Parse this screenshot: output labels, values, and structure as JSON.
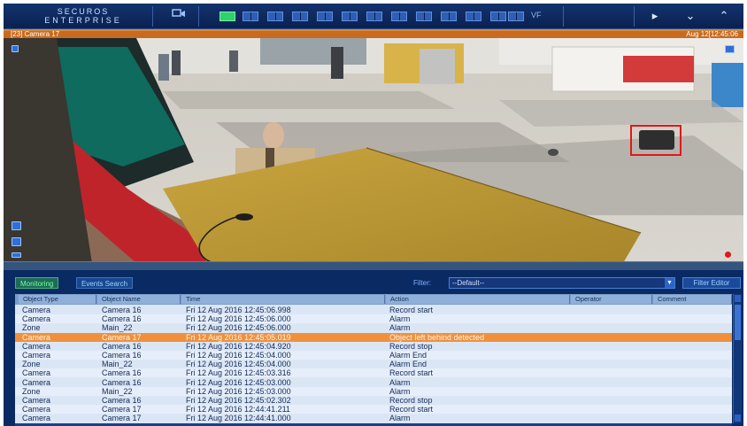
{
  "topbar": {
    "logo_line1": "SECUROS",
    "logo_line2": "ENTERPRISE",
    "layout_label": "VF"
  },
  "camera": {
    "title": "[23] Camera 17",
    "datetime": "Aug 12[12:45:06"
  },
  "events": {
    "tabs": [
      {
        "label": "Monitoring",
        "active": true
      },
      {
        "label": "Events Search",
        "active": false
      }
    ],
    "filter_label": "Filter:",
    "filter_value": "--Default--",
    "filter_editor_label": "Filter Editor",
    "columns": [
      "Object Type",
      "Object Name",
      "Time",
      "Action",
      "Operator",
      "Comment"
    ],
    "rows": [
      {
        "type": "Camera",
        "name": "Camera 16",
        "time": "Fri 12 Aug 2016  12:45:06.998",
        "action": "Record start",
        "selected": false
      },
      {
        "type": "Camera",
        "name": "Camera 16",
        "time": "Fri 12 Aug 2016  12:45:06.000",
        "action": "Alarm",
        "selected": false
      },
      {
        "type": "Zone",
        "name": "Main_22",
        "time": "Fri 12 Aug 2016  12:45:06.000",
        "action": "Alarm",
        "selected": false
      },
      {
        "type": "Camera",
        "name": "Camera 17",
        "time": "Fri 12 Aug 2016  12:45:05.019",
        "action": "Object left behind detected",
        "selected": true
      },
      {
        "type": "Camera",
        "name": "Camera 16",
        "time": "Fri 12 Aug 2016  12:45:04.920",
        "action": "Record stop",
        "selected": false
      },
      {
        "type": "Camera",
        "name": "Camera 16",
        "time": "Fri 12 Aug 2016  12:45:04.000",
        "action": "Alarm End",
        "selected": false
      },
      {
        "type": "Zone",
        "name": "Main_22",
        "time": "Fri 12 Aug 2016  12:45:04.000",
        "action": "Alarm End",
        "selected": false
      },
      {
        "type": "Camera",
        "name": "Camera 16",
        "time": "Fri 12 Aug 2016  12:45:03.316",
        "action": "Record start",
        "selected": false
      },
      {
        "type": "Camera",
        "name": "Camera 16",
        "time": "Fri 12 Aug 2016  12:45:03.000",
        "action": "Alarm",
        "selected": false
      },
      {
        "type": "Zone",
        "name": "Main_22",
        "time": "Fri 12 Aug 2016  12:45:03.000",
        "action": "Alarm",
        "selected": false
      },
      {
        "type": "Camera",
        "name": "Camera 16",
        "time": "Fri 12 Aug 2016  12:45:02.302",
        "action": "Record stop",
        "selected": false
      },
      {
        "type": "Camera",
        "name": "Camera 17",
        "time": "Fri 12 Aug 2016  12:44:41.211",
        "action": "Record start",
        "selected": false
      },
      {
        "type": "Camera",
        "name": "Camera 17",
        "time": "Fri 12 Aug 2016  12:44:41.000",
        "action": "Alarm",
        "selected": false
      }
    ]
  },
  "colors": {
    "selected_row": "#f0903c",
    "detection_box": "#e01818"
  }
}
